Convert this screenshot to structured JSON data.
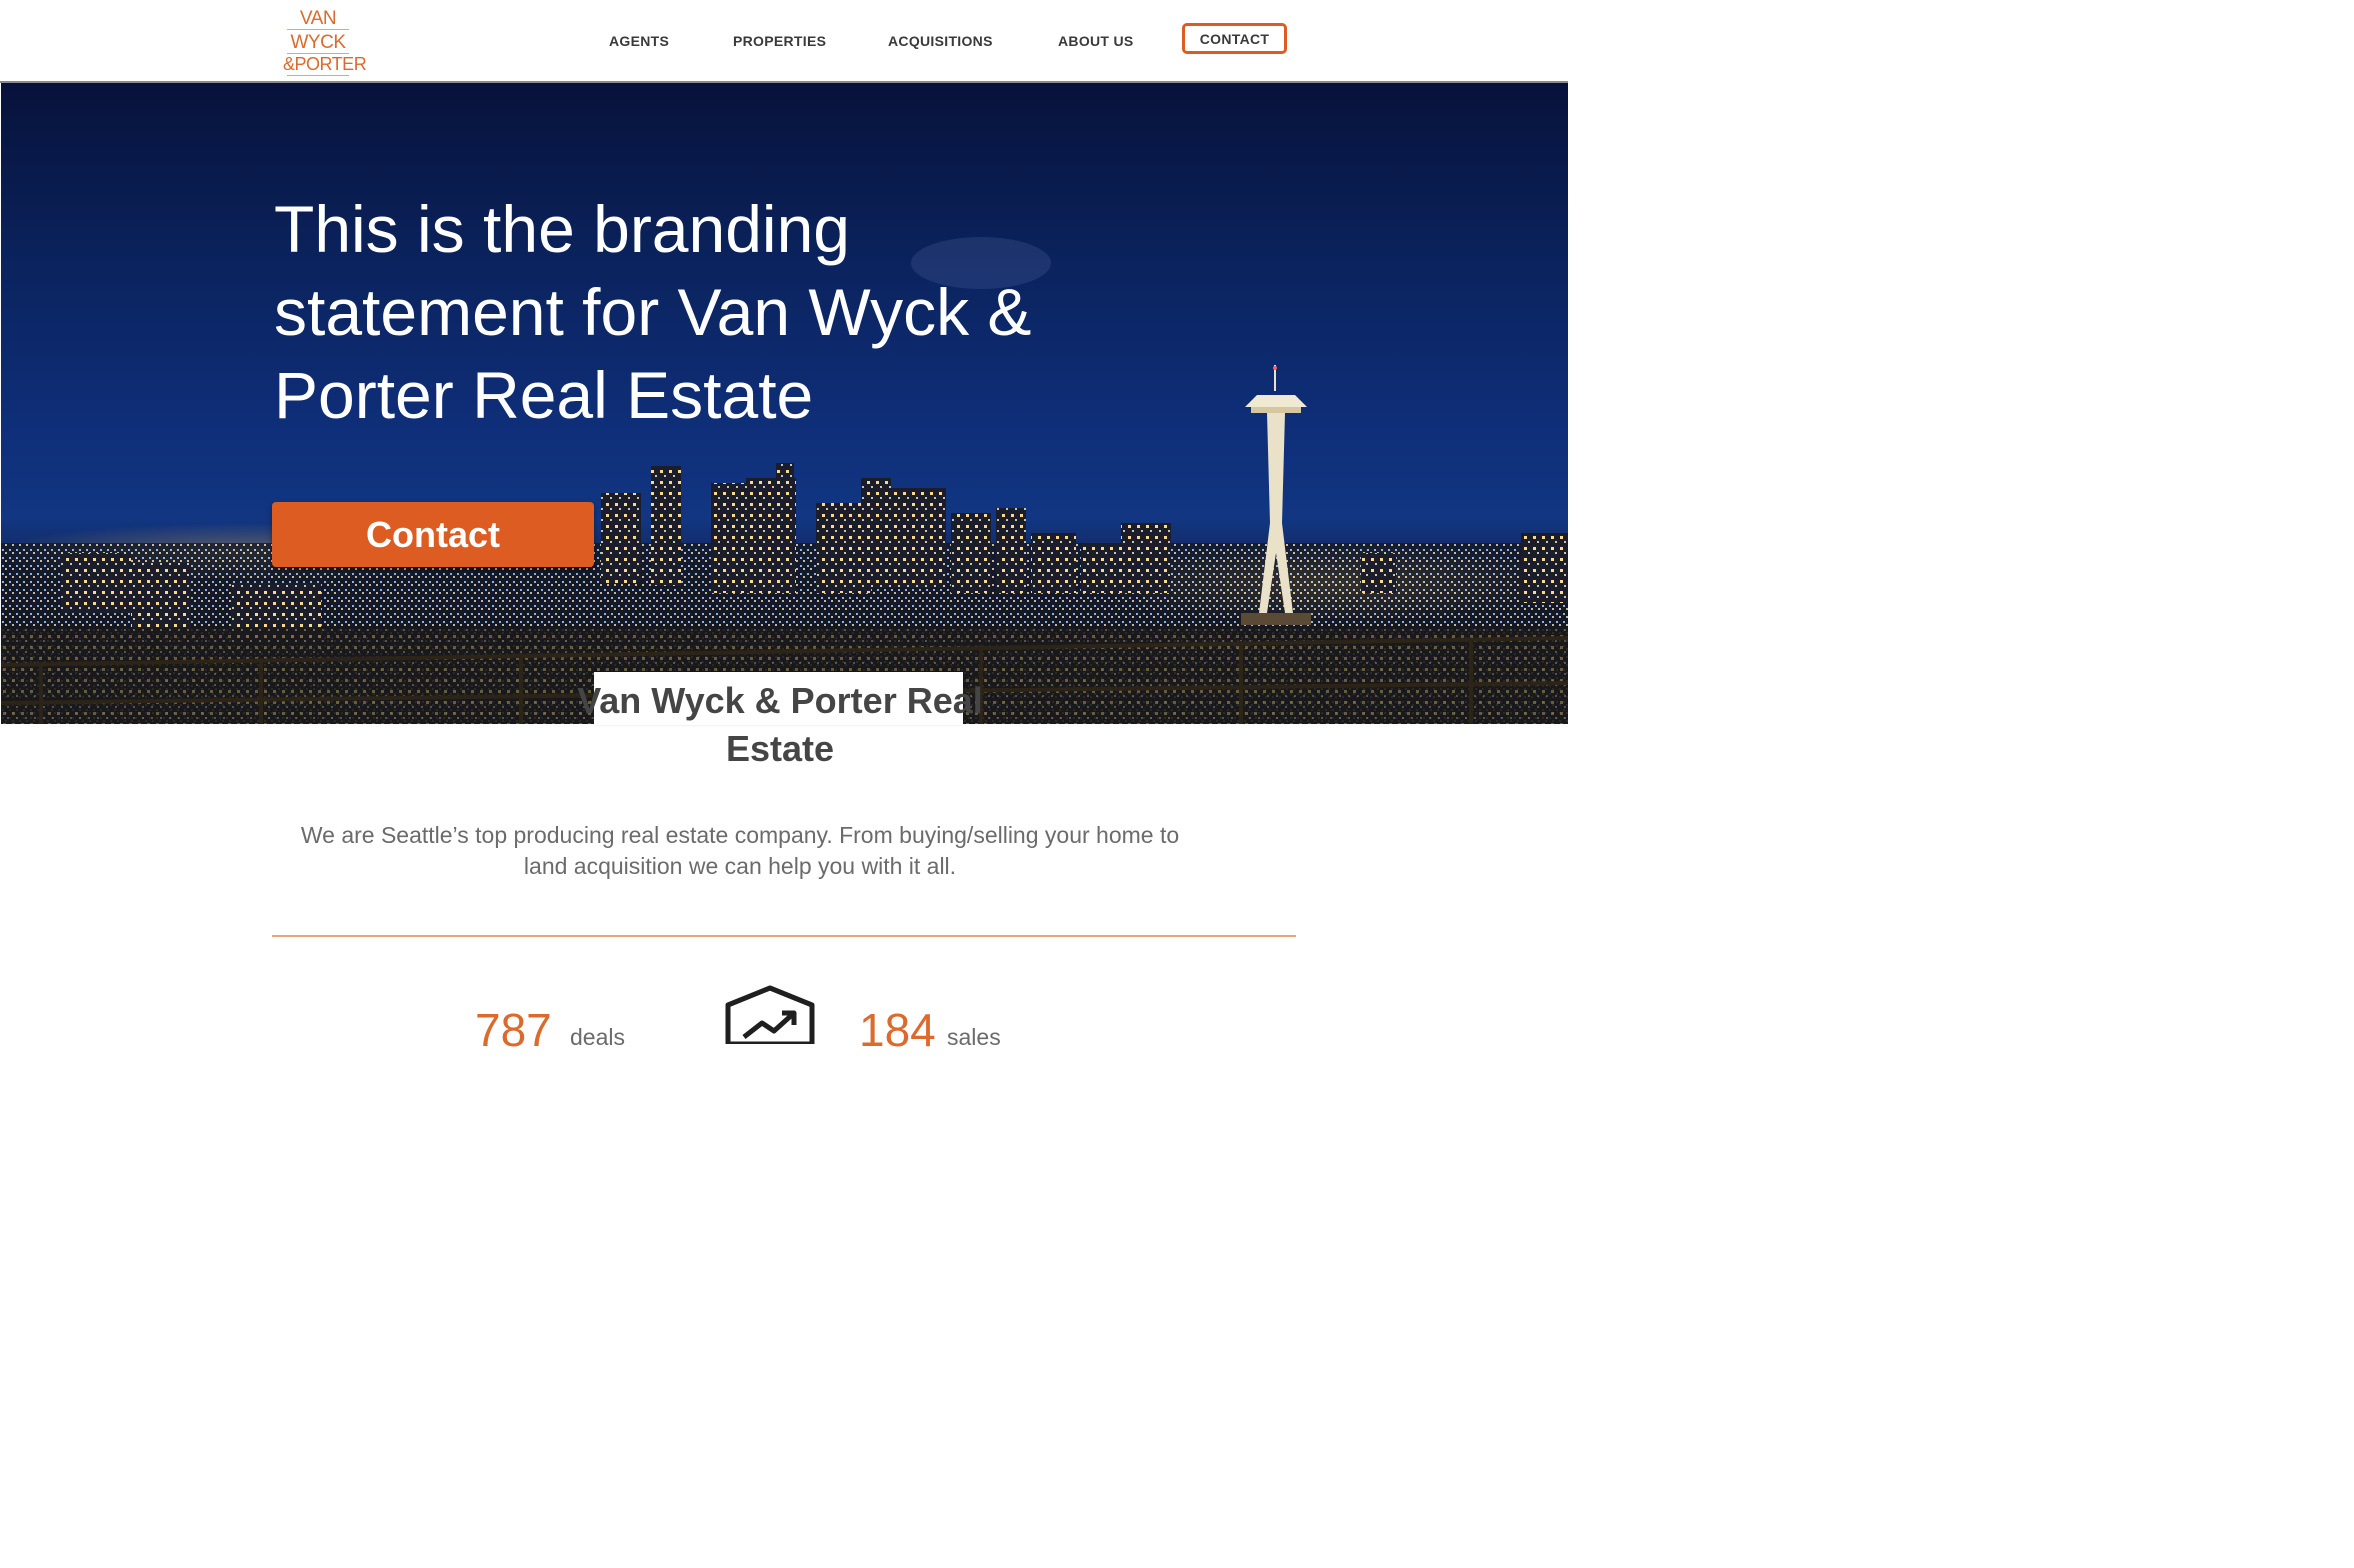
{
  "logo": {
    "line1": "VAN",
    "line2": "WYCK",
    "line3": "&PORTER"
  },
  "nav": {
    "items": [
      "AGENTS",
      "PROPERTIES",
      "ACQUISITIONS",
      "ABOUT US"
    ],
    "contact": "CONTACT"
  },
  "hero": {
    "title": "This is the branding statement for Van Wyck & Porter Real Estate",
    "button": "Contact"
  },
  "company": {
    "name": "Van Wyck & Porter Real Estate"
  },
  "intro": "We are Seattle’s top producing real estate company. From buying/selling your home to land acquisition we can help you with it all.",
  "stats": [
    {
      "value": "787",
      "unit": "deals"
    },
    {
      "value": "184",
      "unit": "sales"
    }
  ],
  "colors": {
    "accent": "#dd5c22",
    "heading": "#454545",
    "body_text": "#6b6b6b",
    "divider": "#e7a57c"
  },
  "icons": {
    "stats_icon": "trending-up-house-icon"
  }
}
